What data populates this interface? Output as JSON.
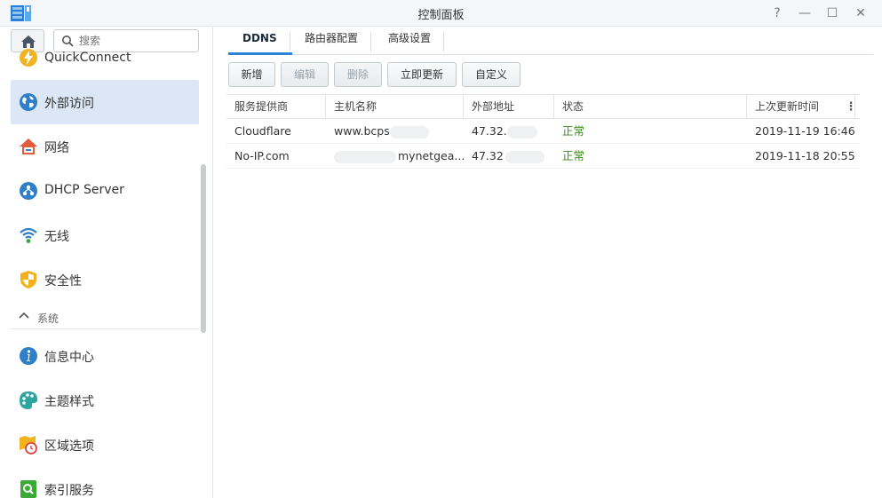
{
  "window": {
    "title": "控制面板",
    "controls": {
      "help": "?",
      "minimize": "—",
      "maximize": "☐",
      "close": "✕"
    }
  },
  "sidebar": {
    "search_placeholder": "搜索",
    "items": [
      {
        "label": "QuickConnect",
        "icon": "quickconnect-icon"
      },
      {
        "label": "外部访问",
        "icon": "globe-icon",
        "active": true
      },
      {
        "label": "网络",
        "icon": "network-home-icon"
      },
      {
        "label": "DHCP Server",
        "icon": "dhcp-icon"
      },
      {
        "label": "无线",
        "icon": "wifi-icon"
      },
      {
        "label": "安全性",
        "icon": "shield-icon"
      }
    ],
    "section": {
      "label": "系统"
    },
    "system_items": [
      {
        "label": "信息中心",
        "icon": "info-icon"
      },
      {
        "label": "主题样式",
        "icon": "palette-icon"
      },
      {
        "label": "区域选项",
        "icon": "region-clock-icon"
      },
      {
        "label": "索引服务",
        "icon": "index-search-icon"
      }
    ]
  },
  "tabs": [
    {
      "label": "DDNS",
      "active": true
    },
    {
      "label": "路由器配置"
    },
    {
      "label": "高级设置"
    }
  ],
  "toolbar": {
    "add": "新增",
    "edit": "编辑",
    "delete": "删除",
    "update_now": "立即更新",
    "customize": "自定义"
  },
  "table": {
    "columns": [
      "服务提供商",
      "主机名称",
      "外部地址",
      "状态",
      "上次更新时间"
    ],
    "rows": [
      {
        "provider": "Cloudflare",
        "hostname": "www.bcps",
        "address": "47.32.",
        "status": "正常",
        "updated": "2019-11-19 16:46"
      },
      {
        "provider": "No-IP.com",
        "hostname": "mynetgea...",
        "address": "47.32",
        "status": "正常",
        "updated": "2019-11-18 20:55"
      }
    ]
  },
  "colors": {
    "accent": "#2b84d8",
    "status_ok": "#3a8e1a",
    "active_bg": "#dbe7f4"
  }
}
